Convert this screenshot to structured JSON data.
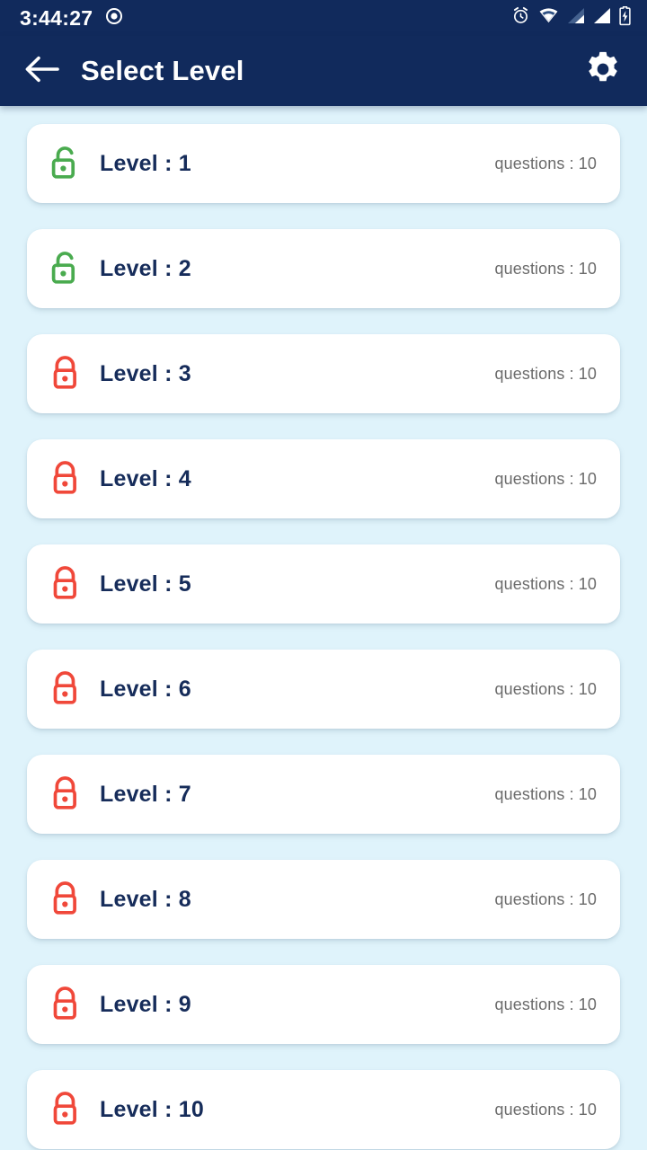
{
  "status_bar": {
    "time": "3:44:27",
    "icons_left": [
      "screen-record-icon"
    ],
    "icons_right": [
      "alarm-icon",
      "wifi-icon",
      "signal-1-icon",
      "signal-2-icon",
      "battery-charging-icon"
    ],
    "background_color": "#112a5c",
    "foreground_color": "#ffffff"
  },
  "app_bar": {
    "title": "Select Level",
    "back_icon": "arrow-left-icon",
    "settings_icon": "gear-icon",
    "background_color": "#112a5c",
    "title_color": "#ffffff"
  },
  "theme": {
    "page_background": "#dff3fb",
    "card_background": "#ffffff",
    "unlocked_color": "#4aab4f",
    "locked_color": "#f0483a",
    "level_text_color": "#162c5a",
    "questions_text_color": "#6b6b6b"
  },
  "levels": [
    {
      "label": "Level : 1",
      "questions": "questions : 10",
      "state": "unlocked",
      "icon": "lock-open-icon"
    },
    {
      "label": "Level : 2",
      "questions": "questions : 10",
      "state": "unlocked",
      "icon": "lock-open-icon"
    },
    {
      "label": "Level : 3",
      "questions": "questions : 10",
      "state": "locked",
      "icon": "lock-closed-icon"
    },
    {
      "label": "Level : 4",
      "questions": "questions : 10",
      "state": "locked",
      "icon": "lock-closed-icon"
    },
    {
      "label": "Level : 5",
      "questions": "questions : 10",
      "state": "locked",
      "icon": "lock-closed-icon"
    },
    {
      "label": "Level : 6",
      "questions": "questions : 10",
      "state": "locked",
      "icon": "lock-closed-icon"
    },
    {
      "label": "Level : 7",
      "questions": "questions : 10",
      "state": "locked",
      "icon": "lock-closed-icon"
    },
    {
      "label": "Level : 8",
      "questions": "questions : 10",
      "state": "locked",
      "icon": "lock-closed-icon"
    },
    {
      "label": "Level : 9",
      "questions": "questions : 10",
      "state": "locked",
      "icon": "lock-closed-icon"
    },
    {
      "label": "Level : 10",
      "questions": "questions : 10",
      "state": "locked",
      "icon": "lock-closed-icon"
    }
  ]
}
